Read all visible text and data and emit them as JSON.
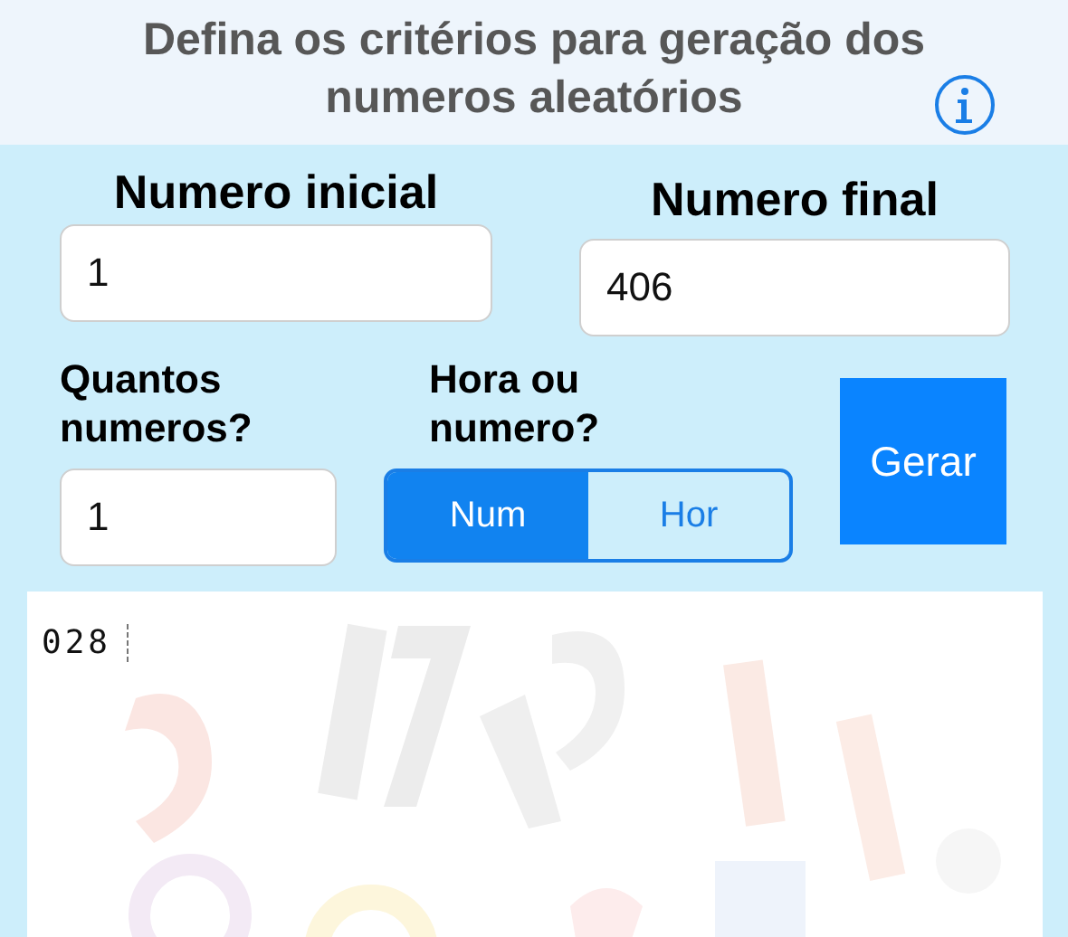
{
  "header": {
    "title": "Defina os critérios para geração dos numeros aleatórios"
  },
  "range": [
    {
      "label": "Numero inicial",
      "value": "1"
    },
    {
      "label": "Numero final",
      "value": "406"
    }
  ],
  "count": {
    "label": "Quantos numeros?",
    "value": "1"
  },
  "mode": {
    "label": "Hora ou numero?",
    "options": [
      {
        "label": "Num",
        "selected": true
      },
      {
        "label": "Hor",
        "selected": false
      }
    ]
  },
  "generate_button": "Gerar",
  "output": {
    "text": "028"
  }
}
